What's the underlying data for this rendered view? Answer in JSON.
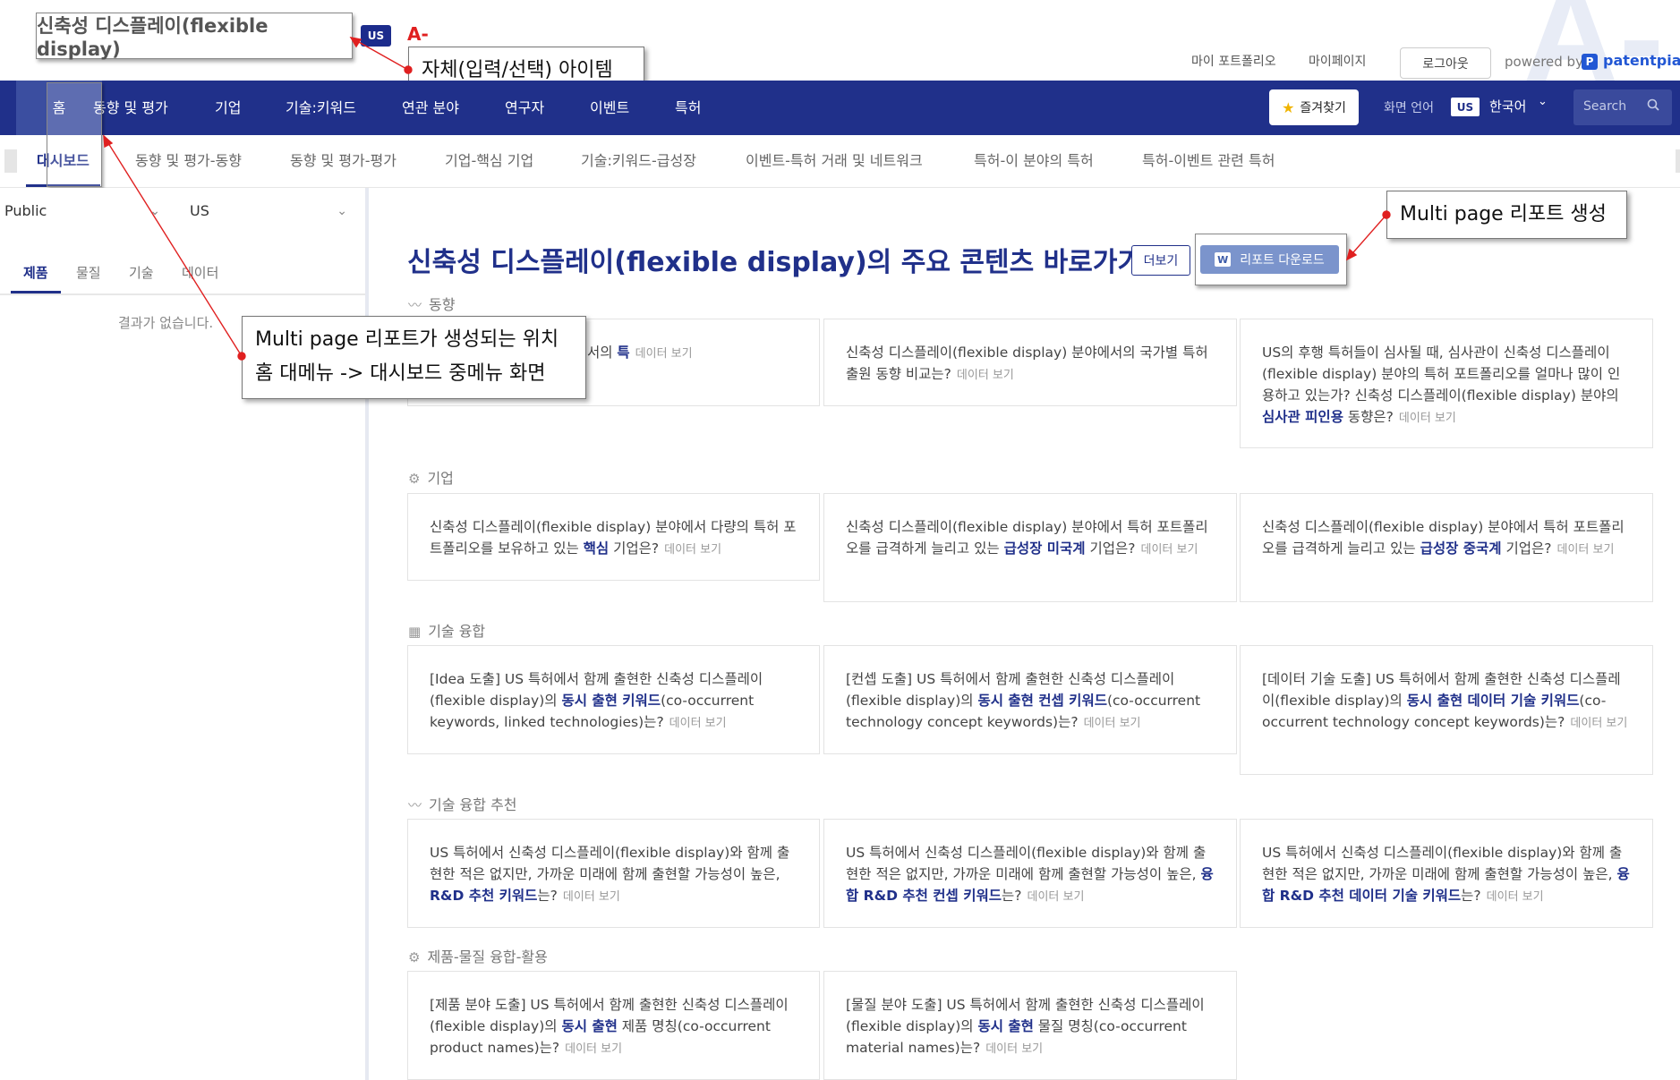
{
  "header": {
    "title_annotation": "신축성 디스플레이(flexible display)",
    "country_badge": "US",
    "a_minus": "A-",
    "callout_item": "자체(입력/선택) 아이템",
    "links": [
      "마이 포트폴리오",
      "마이페이지"
    ],
    "logout": "로그아웃",
    "powered_by": "powered by",
    "brand": "patentpia"
  },
  "nav": {
    "items": [
      "홈",
      "동향 및 평가",
      "기업",
      "기술:키워드",
      "연관 분야",
      "연구자",
      "이벤트",
      "특허"
    ],
    "favorites": "즐겨찾기",
    "lang_label": "화면 언어",
    "lang_country": "US",
    "lang_value": "한국어",
    "search_placeholder": "Search"
  },
  "subnav": {
    "items": [
      "대시보드",
      "동향 및 평가-동향",
      "동향 및 평가-평가",
      "기업-핵심 기업",
      "기술:키워드-급성장",
      "이벤트-특허 거래 및 네트워크",
      "특허-이 분야의 특허",
      "특허-이벤트 관련 특허"
    ]
  },
  "sidebar": {
    "select1": "Public",
    "select2": "US",
    "tabs": [
      "제품",
      "물질",
      "기술",
      "데이터"
    ],
    "no_result": "결과가 없습니다."
  },
  "callouts": {
    "multi_page": "Multi page 리포트 생성",
    "location_line1": "Multi page 리포트가 생성되는 위치",
    "location_line2": "홈 대메뉴 -> 대시보드 중메뉴 화면"
  },
  "main": {
    "title": "신축성 디스플레이(flexible display)의 주요 콘텐츠 바로가기",
    "more": "더보기",
    "report_download": "리포트 다운로드",
    "data_view": "데이터 보기",
    "sections": [
      {
        "title": "동향",
        "icon": "trend-icon"
      },
      {
        "title": "기업",
        "icon": "chip-icon"
      },
      {
        "title": "기술 융합",
        "icon": "grid-icon"
      },
      {
        "title": "기술 융합 추천",
        "icon": "trend-icon"
      },
      {
        "title": "제품-물질 융합-활용",
        "icon": "chip-icon"
      }
    ],
    "cards": [
      {
        "pre": "(flexible display) 분야에서의 ",
        "bold": "특",
        "post": ""
      },
      {
        "pre": "신축성 디스플레이(flexible display) 분야에서의 국가별 특허 출원 동향 비교는?",
        "bold": "",
        "post": ""
      },
      {
        "pre": "US의 후행 특허들이 심사될 때, 심사관이 신축성 디스플레이(flexible display) 분야의 특허 포트폴리오를 얼마나 많이 인용하고 있는가? 신축성 디스플레이(flexible display) 분야의 ",
        "bold": "심사관 피인용",
        "post": " 동향은?"
      },
      {
        "pre": "신축성 디스플레이(flexible display) 분야에서 다량의 특허 포트폴리오를 보유하고 있는 ",
        "bold": "핵심",
        "post": " 기업은?"
      },
      {
        "pre": "신축성 디스플레이(flexible display) 분야에서 특허 포트폴리오를 급격하게 늘리고 있는 ",
        "bold": "급성장 미국계",
        "post": " 기업은?"
      },
      {
        "pre": "신축성 디스플레이(flexible display) 분야에서 특허 포트폴리오를 급격하게 늘리고 있는 ",
        "bold": "급성장 중국계",
        "post": " 기업은?"
      },
      {
        "pre": "[Idea 도출] US 특허에서 함께 출현한 신축성 디스플레이(flexible display)의 ",
        "bold": "동시 출현 키워드",
        "post": "(co-occurrent keywords, linked technologies)는?"
      },
      {
        "pre": "[컨셉 도출] US 특허에서 함께 출현한 신축성 디스플레이(flexible display)의 ",
        "bold": "동시 출현 컨셉 키워드",
        "post": "(co-occurrent technology concept keywords)는?"
      },
      {
        "pre": "[데이터 기술 도출] US 특허에서 함께 출현한 신축성 디스플레이(flexible display)의 ",
        "bold": "동시 출현 데이터 기술 키워드",
        "post": "(co-occurrent technology concept keywords)는?"
      },
      {
        "pre": "US 특허에서 신축성 디스플레이(flexible display)와 함께 출현한 적은 없지만, 가까운 미래에 함께 출현할 가능성이 높은, ",
        "bold": "R&D 추천 키워드",
        "post": "는?"
      },
      {
        "pre": "US 특허에서 신축성 디스플레이(flexible display)와 함께 출현한 적은 없지만, 가까운 미래에 함께 출현할 가능성이 높은, ",
        "bold": "융합 R&D 추천 컨셉 키워드",
        "post": "는?"
      },
      {
        "pre": "US 특허에서 신축성 디스플레이(flexible display)와 함께 출현한 적은 없지만, 가까운 미래에 함께 출현할 가능성이 높은, ",
        "bold": "융합 R&D 추천 데이터 기술 키워드",
        "post": "는?"
      },
      {
        "pre": "[제품 분야 도출] US 특허에서 함께 출현한 신축성 디스플레이(flexible display)의 ",
        "bold": "동시 출현",
        "post": " 제품 명칭(co-occurrent product names)는?"
      },
      {
        "pre": "[물질 분야 도출] US 특허에서 함께 출현한 신축성 디스플레이(flexible display)의 ",
        "bold": "동시 출현",
        "post": " 물질 명칭(co-occurrent material names)는?"
      }
    ]
  },
  "colors": {
    "brand": "#20308a",
    "annotation_red": "#e02020"
  }
}
